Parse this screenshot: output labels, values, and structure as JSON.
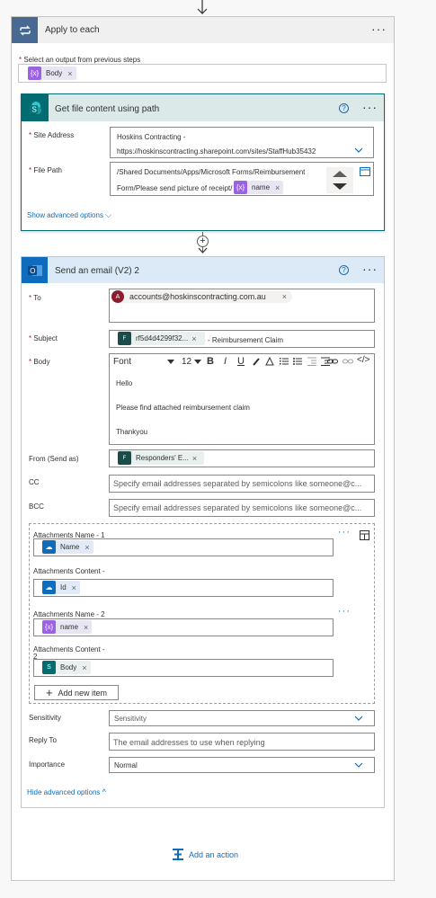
{
  "apply": {
    "title": "Apply to each",
    "select_label": "Select an output from previous steps",
    "body_token": "Body"
  },
  "get_file": {
    "title": "Get file content using path",
    "site_address_label": "Site Address",
    "site_line1": "Hoskins Contracting -",
    "site_line2": "https://hoskinscontracting.sharepoint.com/sites/StaffHub35432",
    "file_path_label": "File Path",
    "path_line1": "/Shared Documents/Apps/Microsoft Forms/Reimbursement",
    "path_line2": "Form/Please send picture of receipt/",
    "name_token": "name",
    "show_advanced": "Show advanced options"
  },
  "email": {
    "title": "Send an email (V2) 2",
    "to_label": "To",
    "to_value": "accounts@hoskinscontracting.com.au",
    "avatar_letter": "A",
    "subject_label": "Subject",
    "subject_token": "rf5d4d4299f32...",
    "subject_text": "- Reimbursement Claim",
    "body_label": "Body",
    "font_label": "Font",
    "font_size": "12",
    "body_lines": [
      "Hello",
      "Please find attached reimbursement claim",
      "Thankyou"
    ],
    "from_label": "From (Send as)",
    "from_token": "Responders' E...",
    "cc_label": "CC",
    "cc_placeholder": "Specify email addresses separated by semicolons like someone@c...",
    "bcc_label": "BCC",
    "bcc_placeholder": "Specify email addresses separated by semicolons like someone@c...",
    "att_name1_label": "Attachments Name - 1",
    "att_name1_token": "Name",
    "att_content1_label": "Attachments Content -",
    "att_content1_token": "Id",
    "att_name2_label": "Attachments Name - 2",
    "att_name2_token": "name",
    "att_content2_label": "Attachments Content -",
    "att_content2_suffix": "2",
    "att_content2_token": "Body",
    "add_item": "Add new item",
    "sensitivity_label": "Sensitivity",
    "sensitivity_value": "Sensitivity",
    "reply_to_label": "Reply To",
    "reply_to_placeholder": "The email addresses to use when replying",
    "importance_label": "Importance",
    "importance_value": "Normal",
    "hide_advanced": "Hide advanced options"
  },
  "add_action": "Add an action",
  "colors": {
    "accent": "#0f6cbd",
    "apply_header": "#f0f0f0",
    "sharepoint_header": "#dbe9e8",
    "outlook_header": "#dce9f6",
    "purple_token": "#9b63e3"
  }
}
